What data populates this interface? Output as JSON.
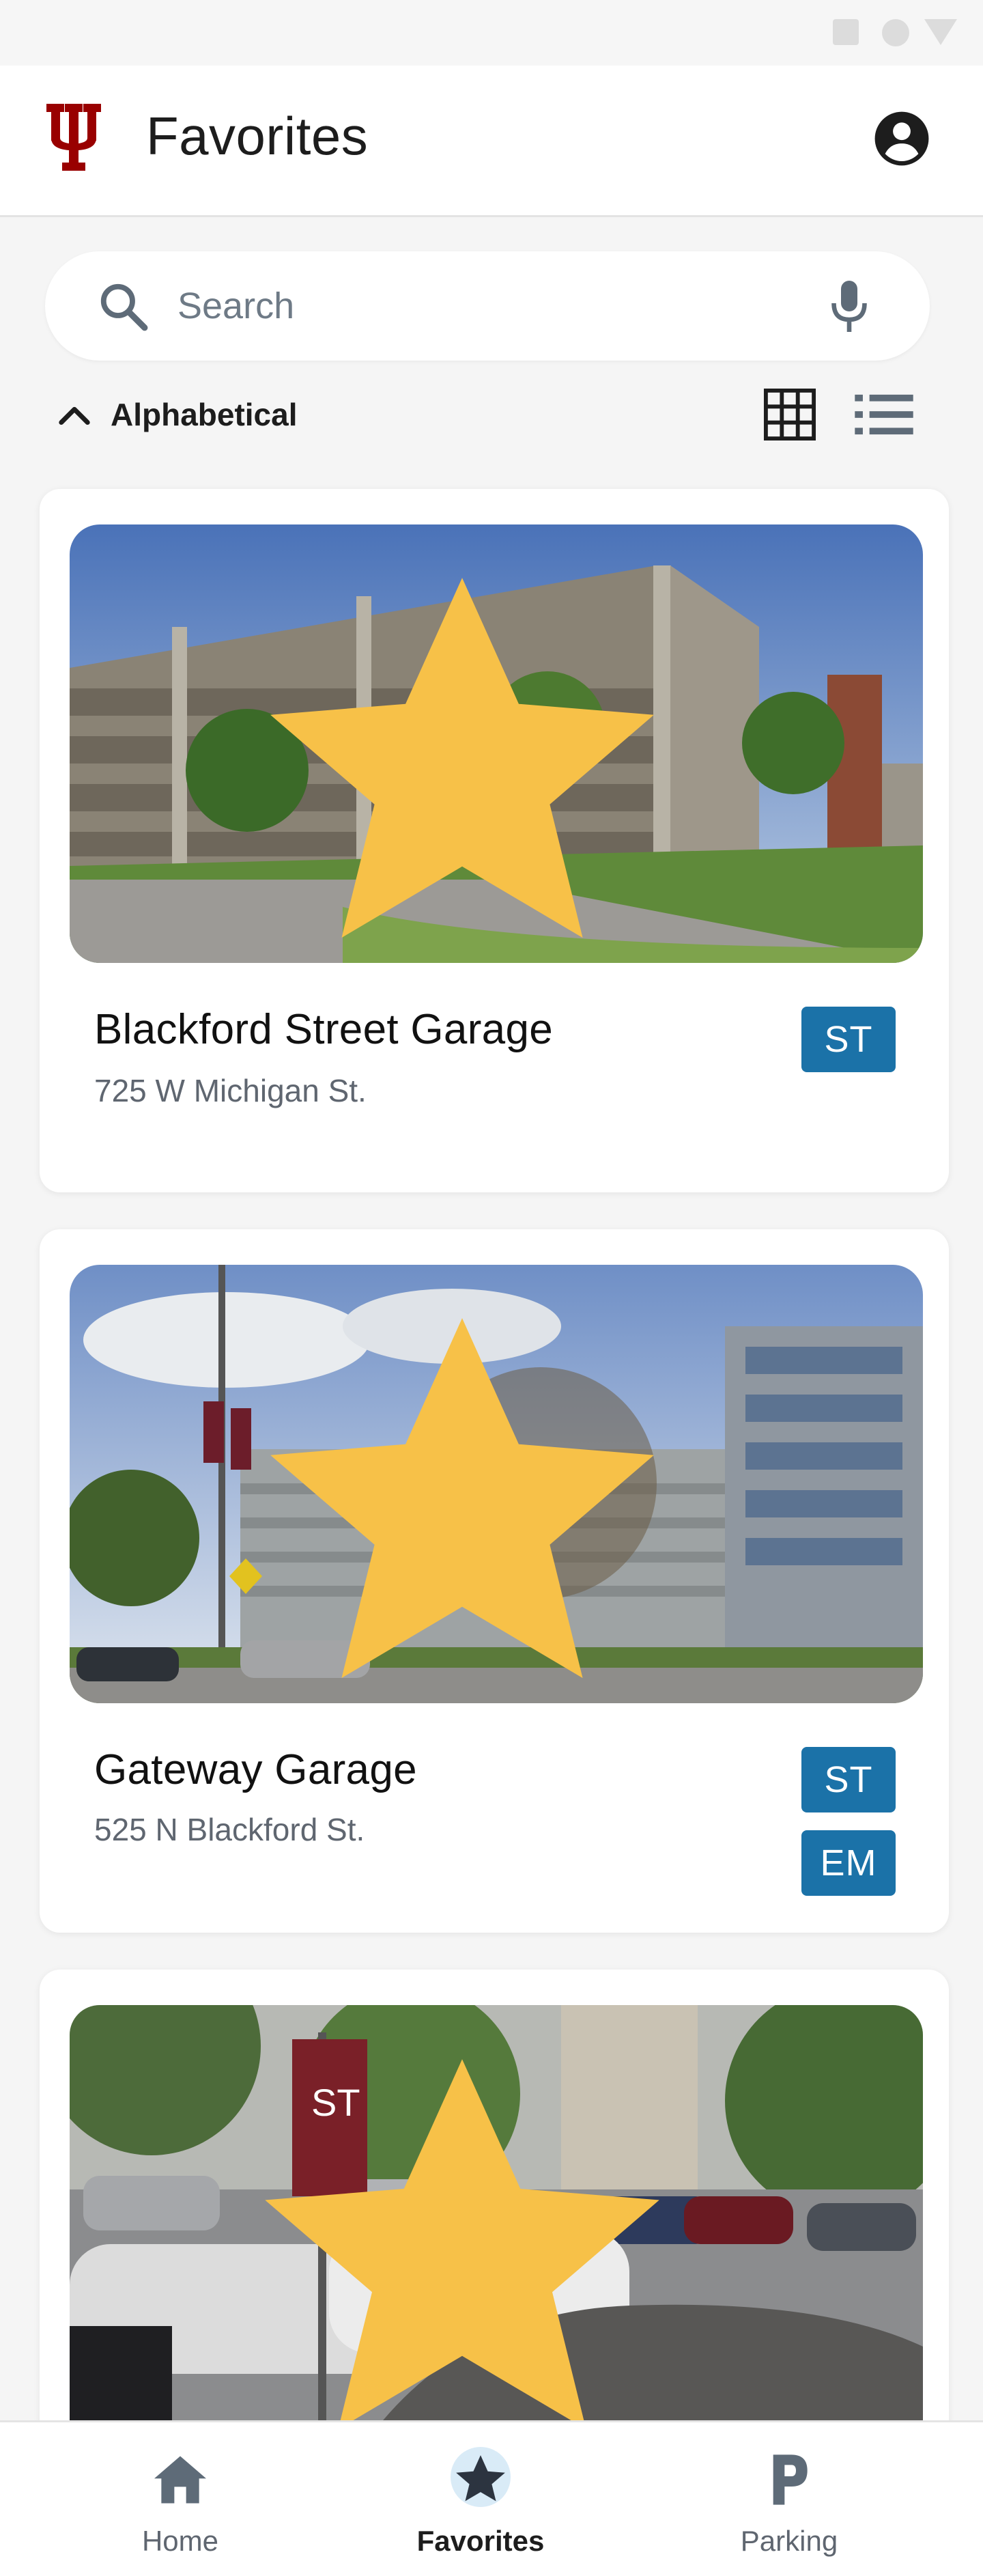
{
  "header": {
    "title": "Favorites",
    "logo_icon": "iu-trident-logo",
    "account_icon": "account-circle-icon",
    "brand_color": "#990000"
  },
  "search": {
    "placeholder": "Search",
    "value": ""
  },
  "sort": {
    "label": "Alphabetical",
    "direction": "ascending",
    "views": [
      "grid-view",
      "list-view"
    ]
  },
  "favorites": [
    {
      "name": "Blackford Street Garage",
      "address": "725 W Michigan St.",
      "badges": [
        "ST"
      ],
      "favorited": true
    },
    {
      "name": "Gateway Garage",
      "address": "525 N Blackford St.",
      "badges": [
        "ST",
        "EM"
      ],
      "favorited": true
    },
    {
      "sign_text": "ST",
      "favorited": true
    }
  ],
  "nav": {
    "items": [
      {
        "label": "Home",
        "icon": "home-icon",
        "active": false
      },
      {
        "label": "Favorites",
        "icon": "star-icon",
        "active": true
      },
      {
        "label": "Parking",
        "icon": "parking-icon",
        "active": false
      }
    ]
  },
  "colors": {
    "badge": "#1b72a8",
    "star": "#f7c148",
    "active_nav_bg": "#d9ebf7"
  }
}
